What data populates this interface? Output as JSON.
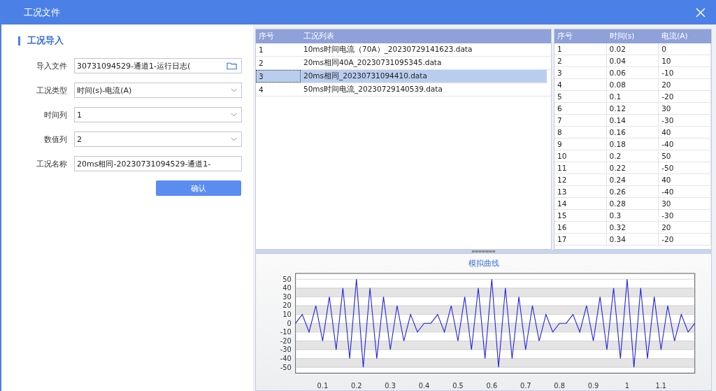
{
  "window": {
    "title": "工况文件"
  },
  "section_title": "工况导入",
  "form": [
    {
      "kind": "file",
      "label": "导入文件",
      "value": "30731094529-通道1-运行日志("
    },
    {
      "kind": "select",
      "label": "工况类型",
      "value": "时间(s)-电流(A)"
    },
    {
      "kind": "select",
      "label": "时间列",
      "value": "1"
    },
    {
      "kind": "select",
      "label": "数值列",
      "value": "2"
    },
    {
      "kind": "text",
      "label": "工况名称",
      "value": "20ms相同-20230731094529-通道1-"
    }
  ],
  "confirm_button": "确认",
  "file_list": {
    "columns": [
      "序号",
      "工况列表"
    ],
    "rows": [
      {
        "cells": [
          "1",
          "10ms时间电流（70A）_20230729141623.data"
        ],
        "selected": false
      },
      {
        "cells": [
          "2",
          "20ms相同40A_20230731095345.data"
        ],
        "selected": false
      },
      {
        "cells": [
          "3",
          "20ms相同_20230731094410.data"
        ],
        "selected": true
      },
      {
        "cells": [
          "4",
          "50ms时间电流_20230729140539.data"
        ],
        "selected": false
      }
    ]
  },
  "data_table": {
    "columns": [
      "序号",
      "时间(s)",
      "电流(A)"
    ],
    "rows": [
      [
        "1",
        "0.02",
        "0"
      ],
      [
        "2",
        "0.04",
        "10"
      ],
      [
        "3",
        "0.06",
        "-10"
      ],
      [
        "4",
        "0.08",
        "20"
      ],
      [
        "5",
        "0.1",
        "-20"
      ],
      [
        "6",
        "0.12",
        "30"
      ],
      [
        "7",
        "0.14",
        "-30"
      ],
      [
        "8",
        "0.16",
        "40"
      ],
      [
        "9",
        "0.18",
        "-40"
      ],
      [
        "10",
        "0.2",
        "50"
      ],
      [
        "11",
        "0.22",
        "-50"
      ],
      [
        "12",
        "0.24",
        "40"
      ],
      [
        "13",
        "0.26",
        "-40"
      ],
      [
        "14",
        "0.28",
        "30"
      ],
      [
        "15",
        "0.3",
        "-30"
      ],
      [
        "16",
        "0.32",
        "20"
      ],
      [
        "17",
        "0.34",
        "-20"
      ]
    ]
  },
  "chart": {
    "chart_data": {
      "type": "line",
      "title": "模拟曲线",
      "x": [
        0.02,
        0.04,
        0.06,
        0.08,
        0.1,
        0.12,
        0.14,
        0.16,
        0.18,
        0.2,
        0.22,
        0.24,
        0.26,
        0.28,
        0.3,
        0.32,
        0.34,
        0.36,
        0.38,
        0.4,
        0.42,
        0.44,
        0.46,
        0.48,
        0.5,
        0.52,
        0.54,
        0.56,
        0.58,
        0.6,
        0.62,
        0.64,
        0.66,
        0.68,
        0.7,
        0.72,
        0.74,
        0.76,
        0.78,
        0.8,
        0.82,
        0.84,
        0.86,
        0.88,
        0.9,
        0.92,
        0.94,
        0.96,
        0.98,
        1.0,
        1.02,
        1.04,
        1.06,
        1.08,
        1.1,
        1.12,
        1.14,
        1.16,
        1.18,
        1.2
      ],
      "series": [
        {
          "color": "#2020e0",
          "values": [
            0,
            10,
            -10,
            20,
            -20,
            30,
            -30,
            40,
            -40,
            50,
            -50,
            40,
            -40,
            30,
            -30,
            20,
            -20,
            10,
            -10,
            0,
            0,
            10,
            -10,
            20,
            -20,
            30,
            -30,
            40,
            -40,
            50,
            -50,
            40,
            -40,
            30,
            -30,
            20,
            -20,
            10,
            -10,
            0,
            0,
            10,
            -10,
            20,
            -20,
            30,
            -30,
            40,
            -40,
            50,
            -50,
            40,
            -40,
            30,
            -30,
            20,
            -20,
            10,
            -10,
            0
          ]
        }
      ],
      "grid": true,
      "xlim": [
        0.02,
        1.2
      ],
      "ylim": [
        -55,
        55
      ],
      "xticks": [
        {
          "value": 0.1,
          "label": "0.1"
        },
        {
          "value": 0.2,
          "label": "0.2"
        },
        {
          "value": 0.3,
          "label": "0.3"
        },
        {
          "value": 0.4,
          "label": "0.4"
        },
        {
          "value": 0.5,
          "label": "0.5"
        },
        {
          "value": 0.6,
          "label": "0.6"
        },
        {
          "value": 0.7,
          "label": "0.7"
        },
        {
          "value": 0.8,
          "label": "0.8"
        },
        {
          "value": 0.9,
          "label": "0.9"
        },
        {
          "value": 1,
          "label": "1"
        },
        {
          "value": 1.1,
          "label": "1.1"
        }
      ],
      "yticks": [
        50,
        40,
        30,
        20,
        10,
        0,
        -10,
        -20,
        -30,
        -40,
        -50
      ]
    }
  }
}
